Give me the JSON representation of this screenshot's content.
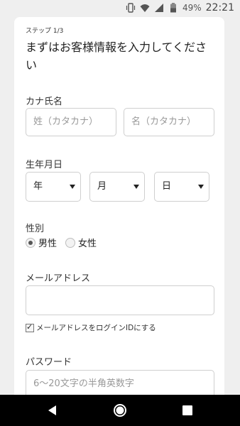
{
  "status_bar": {
    "battery": "49%",
    "time": "22:21",
    "icons": [
      "vibrate-icon",
      "wifi-icon",
      "signal-icon",
      "battery-icon"
    ]
  },
  "form": {
    "step": "ステップ 1/3",
    "headline_line1": "まずはお客様情報を入力してくださ",
    "headline_line2": "い",
    "kana_name": {
      "label": "カナ氏名",
      "last_placeholder": "姓（カタカナ）",
      "first_placeholder": "名（カタカナ）"
    },
    "birth": {
      "label": "生年月日",
      "year": "年",
      "month": "月",
      "day": "日"
    },
    "gender": {
      "label": "性別",
      "options": [
        "男性",
        "女性"
      ],
      "selected": "男性"
    },
    "email": {
      "label": "メールアドレス",
      "value": "",
      "use_as_login_label": "メールアドレスをログインIDにする",
      "use_as_login_checked": true
    },
    "password": {
      "label": "パスワード",
      "placeholder": "6〜20文字の半角英数字"
    }
  },
  "navbar": {
    "icons": [
      "back-icon",
      "home-icon",
      "recents-icon"
    ]
  }
}
